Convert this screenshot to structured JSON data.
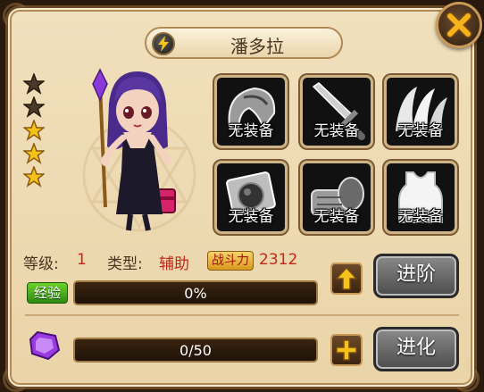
{
  "hero": {
    "name": "潘多拉",
    "stars_filled": 3,
    "stars_total": 5
  },
  "equipment": {
    "empty_label": "无装备",
    "slots": [
      {
        "icon": "shoulder-armor-icon"
      },
      {
        "icon": "sword-icon"
      },
      {
        "icon": "claw-icon"
      },
      {
        "icon": "amulet-icon"
      },
      {
        "icon": "gauntlet-icon"
      },
      {
        "icon": "tank-top-icon"
      }
    ]
  },
  "stats": {
    "level_label": "等级:",
    "level": "1",
    "type_label": "类型:",
    "type": "辅助",
    "power_label": "战斗力",
    "power": "2312"
  },
  "exp": {
    "label": "经验",
    "text": "0%",
    "progress": 0
  },
  "evolve": {
    "text": "0/50",
    "progress": 0
  },
  "buttons": {
    "advance": "进阶",
    "evolve": "进化"
  },
  "colors": {
    "accent_red": "#c2281a",
    "exp_green": "#4caf1a",
    "gold": "#f5c21a"
  }
}
